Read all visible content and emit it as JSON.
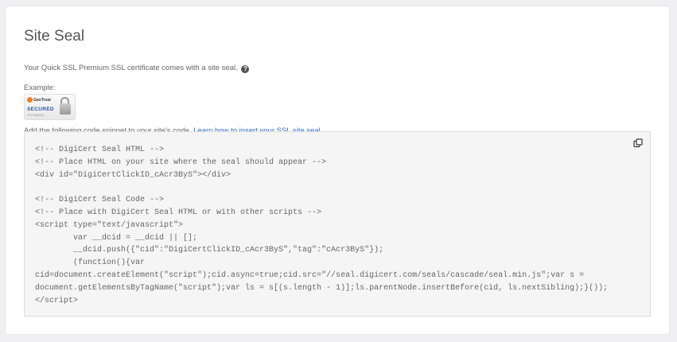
{
  "title": "Site Seal",
  "description": "Your Quick SSL Premium SSL certificate comes with a site seal.",
  "help_icon": "?",
  "example_label": "Example:",
  "seal": {
    "brand": "GeoTrust",
    "secured": "SECURED",
    "date": "YYYY.MM.DD"
  },
  "instructions": "Add the following code snippet to your site's code.",
  "learn_link": "Learn how to insert your SSL site seal.",
  "code_snippet": "<!-- DigiCert Seal HTML -->\n<!-- Place HTML on your site where the seal should appear -->\n<div id=\"DigiCertClickID_cAcr3ByS\"></div>\n\n<!-- DigiCert Seal Code -->\n<!-- Place with DigiCert Seal HTML or with other scripts -->\n<script type=\"text/javascript\">\n        var __dcid = __dcid || [];\n        __dcid.push({\"cid\":\"DigiCertClickID_cAcr3ByS\",\"tag\":\"cAcr3ByS\"});\n        (function(){var\ncid=document.createElement(\"script\");cid.async=true;cid.src=\"//seal.digicert.com/seals/cascade/seal.min.js\";var s =\ndocument.getElementsByTagName(\"script\");var ls = s[(s.length - 1)];ls.parentNode.insertBefore(cid, ls.nextSibling);}());\n</script>"
}
